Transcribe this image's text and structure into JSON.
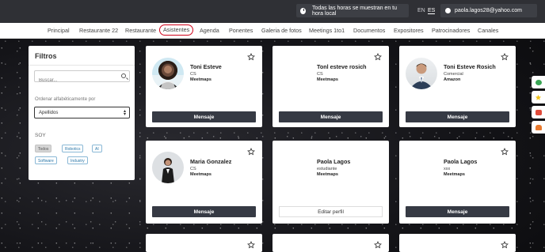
{
  "topbar": {
    "timezone_text": "Todas las horas se muestran en tu hora local",
    "lang_en": "EN",
    "lang_es": "ES",
    "user_email": "paola.lagos28@yahoo.com"
  },
  "nav": {
    "items": [
      "Principal",
      "Restaurante 22",
      "Restaurante",
      "Asistentes",
      "Agenda",
      "Ponentes",
      "Galeria de fotos",
      "Meetings 1to1",
      "Documentos",
      "Expositores",
      "Patrocinadores",
      "Canales"
    ],
    "active": "Asistentes"
  },
  "filters": {
    "title": "Filtros",
    "search_placeholder": "Buscar...",
    "sort_label": "Ordenar alfabéticamente por",
    "sort_value": "Apellidos",
    "soy_label": "SOY",
    "chips": [
      "Todos",
      "Robotics",
      "AI",
      "Software",
      "Industry"
    ]
  },
  "cards": [
    {
      "name": "Toni Esteve",
      "role": "CS",
      "company": "Meetmaps",
      "button": "Mensaje",
      "avatar": "woman-avatar"
    },
    {
      "name": "Tonl esteve rosich",
      "role": "CS",
      "company": "Meetmaps",
      "button": "Mensaje",
      "avatar": ""
    },
    {
      "name": "Toni Esteve Rosich",
      "role": "Comercial",
      "company": "Amazon",
      "button": "Mensaje",
      "avatar": "man-avatar"
    },
    {
      "name": "Maria Gonzalez",
      "role": "CS",
      "company": "Meetmaps",
      "button": "Mensaje",
      "avatar": "woman-avatar"
    },
    {
      "name": "Paola Lagos",
      "role": "estudiante",
      "company": "Meetmaps",
      "button": "Editar perfil",
      "avatar": ""
    },
    {
      "name": "Paola Lagos",
      "role": "xxx",
      "company": "Meetmaps",
      "button": "Mensaje",
      "avatar": ""
    }
  ],
  "colors": {
    "topbar_bg": "#2f3035",
    "button_dark": "#363a44",
    "active_nav_border": "#d0021b",
    "chip_border": "#8ab8d6"
  },
  "side_widgets": [
    "chat-icon",
    "star-icon",
    "sos-icon",
    "bell-icon"
  ]
}
